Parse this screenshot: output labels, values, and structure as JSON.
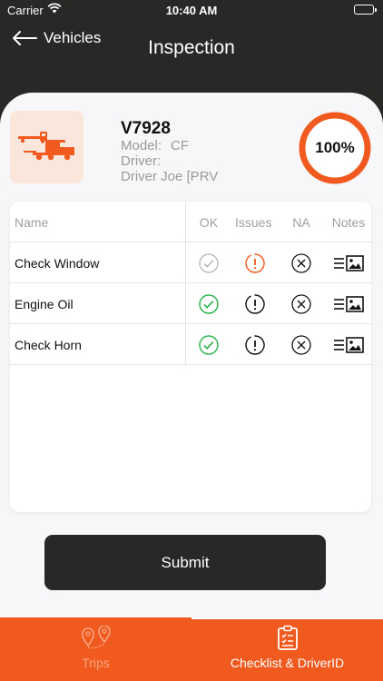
{
  "status_bar": {
    "carrier": "Carrier",
    "time": "10:40 AM"
  },
  "nav": {
    "back_label": "Vehicles",
    "title": "Inspection"
  },
  "vehicle": {
    "id": "V7928",
    "model_label": "Model:",
    "model_value": "CF",
    "driver_label": "Driver:",
    "driver_value": "Driver Joe [PRV"
  },
  "progress": {
    "label": "100%",
    "value": 1.0
  },
  "checklist": {
    "headers": {
      "name": "Name",
      "ok": "OK",
      "issues": "Issues",
      "na": "NA",
      "notes": "Notes"
    },
    "items": [
      {
        "name": "Check Window",
        "status": "issues"
      },
      {
        "name": "Engine Oil",
        "status": "ok"
      },
      {
        "name": "Check Horn",
        "status": "ok"
      }
    ]
  },
  "submit_label": "Submit",
  "tabs": [
    {
      "label": "Trips",
      "icon": "route-pins-icon",
      "active": false
    },
    {
      "label": "Checklist & DriverID",
      "icon": "clipboard-checklist-icon",
      "active": true
    }
  ],
  "colors": {
    "accent": "#f05a1f",
    "dark": "#2a2727",
    "ok_green": "#27b24a",
    "inactive_gray": "#9a9a9a"
  }
}
